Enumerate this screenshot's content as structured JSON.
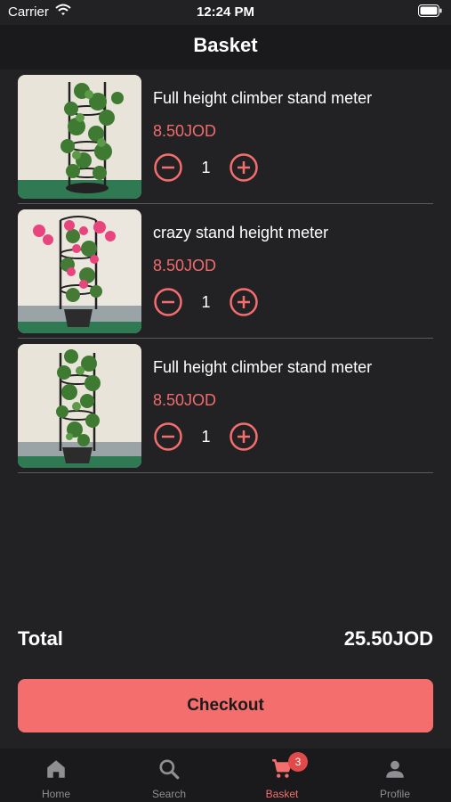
{
  "status": {
    "carrier": "Carrier",
    "time": "12:24 PM"
  },
  "header": {
    "title": "Basket"
  },
  "items": [
    {
      "name": "Full height climber stand meter",
      "price": "8.50JOD",
      "quantity": "1"
    },
    {
      "name": "crazy stand height meter",
      "price": "8.50JOD",
      "quantity": "1"
    },
    {
      "name": "Full height climber stand meter",
      "price": "8.50JOD",
      "quantity": "1"
    }
  ],
  "summary": {
    "total_label": "Total",
    "total_value": "25.50JOD"
  },
  "checkout": {
    "label": "Checkout"
  },
  "tabs": [
    {
      "label": "Home",
      "icon": "home-icon"
    },
    {
      "label": "Search",
      "icon": "search-icon"
    },
    {
      "label": "Basket",
      "icon": "cart-icon",
      "badge": "3"
    },
    {
      "label": "Profile",
      "icon": "person-icon"
    }
  ],
  "colors": {
    "accent": "#f56e6e",
    "background": "#222225",
    "bar": "#1a1a1c",
    "badge": "#e04a4a"
  }
}
